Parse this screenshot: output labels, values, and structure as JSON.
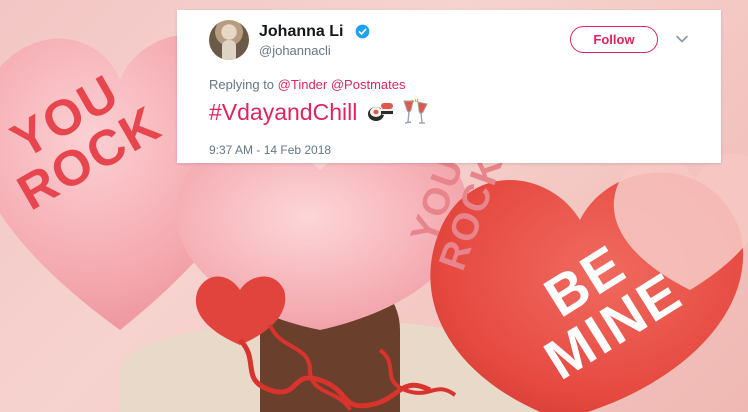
{
  "tweet": {
    "display_name": "Johanna Li",
    "handle": "@johannacli",
    "follow_label": "Follow",
    "replying_prefix": "Replying to",
    "mentions": [
      "@Tinder",
      "@Postmates"
    ],
    "hashtag": "#VdayandChill",
    "emojis": [
      "sushi-icon",
      "clinking-glasses-icon"
    ],
    "timestamp": "9:37 AM - 14 Feb 2018",
    "verified": true
  },
  "background": {
    "balloon_texts": [
      "YOU\nROCK",
      "YOU\nROCK",
      "BE\nMINE"
    ]
  },
  "colors": {
    "accent": "#e0245e",
    "verified": "#1da1f2",
    "text_primary": "#14171a",
    "text_secondary": "#657786",
    "balloon_pink": "#f5a9b0",
    "balloon_red": "#e84a43"
  }
}
